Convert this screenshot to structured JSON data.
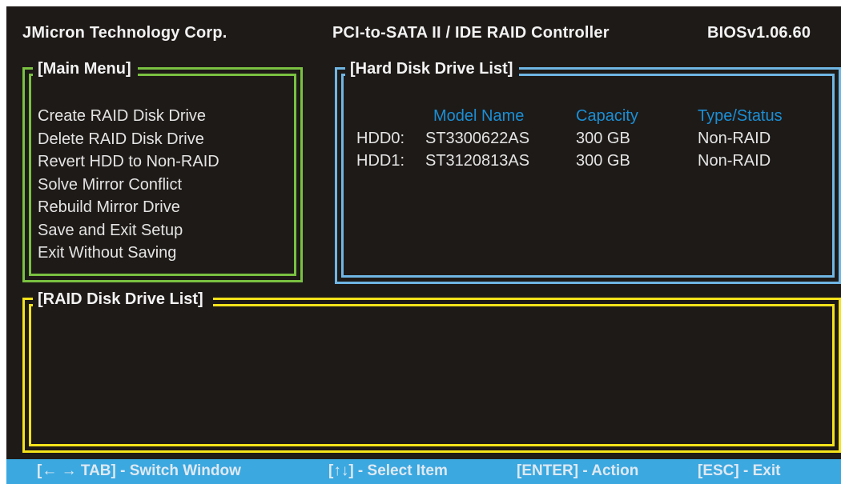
{
  "header": {
    "vendor": "JMicron Technology Corp.",
    "controller": "PCI-to-SATA II / IDE RAID Controller",
    "bios_version": "BIOSv1.06.60"
  },
  "main_menu": {
    "title": "[Main Menu]",
    "items": [
      "Create RAID Disk Drive",
      "Delete RAID Disk Drive",
      "Revert HDD to Non-RAID",
      "Solve Mirror Conflict",
      "Rebuild Mirror Drive",
      "Save and Exit Setup",
      "Exit Without Saving"
    ]
  },
  "hdd_list": {
    "title": "[Hard Disk Drive List]",
    "columns": {
      "model": "Model Name",
      "capacity": "Capacity",
      "type_status": "Type/Status"
    },
    "rows": [
      {
        "id": "HDD0:",
        "model": "ST3300622AS",
        "capacity": "300 GB",
        "status": "Non-RAID"
      },
      {
        "id": "HDD1:",
        "model": "ST3120813AS",
        "capacity": "300 GB",
        "status": "Non-RAID"
      }
    ]
  },
  "raid_list": {
    "title": "[RAID Disk Drive List]"
  },
  "footer": {
    "switch_window": "[← → TAB] - Switch Window",
    "select_item": "[↑↓] - Select Item",
    "action": "[ENTER] - Action",
    "exit": "[ESC] - Exit"
  },
  "colors": {
    "background": "#1e1a17",
    "main_menu_frame": "#7ac142",
    "hdd_frame": "#6fb6e4",
    "raid_frame": "#f4e21b",
    "column_header": "#1a8fd6",
    "footer_bar": "#3ba8e0"
  }
}
